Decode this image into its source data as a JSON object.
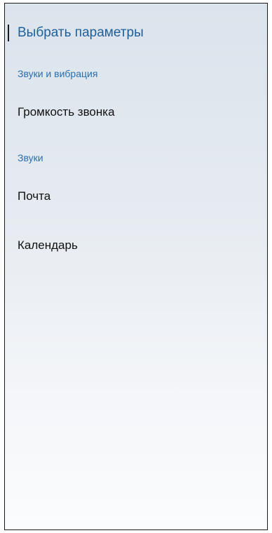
{
  "header": {
    "title": "Выбрать параметры"
  },
  "sections": [
    {
      "header": "Звуки и вибрация",
      "items": [
        "Громкость звонка"
      ]
    },
    {
      "header": "Звуки",
      "items": [
        "Почта",
        "Календарь"
      ]
    }
  ],
  "colors": {
    "accent": "#1f5f9a",
    "section_header": "#2a6fae",
    "item_text": "#111111"
  }
}
